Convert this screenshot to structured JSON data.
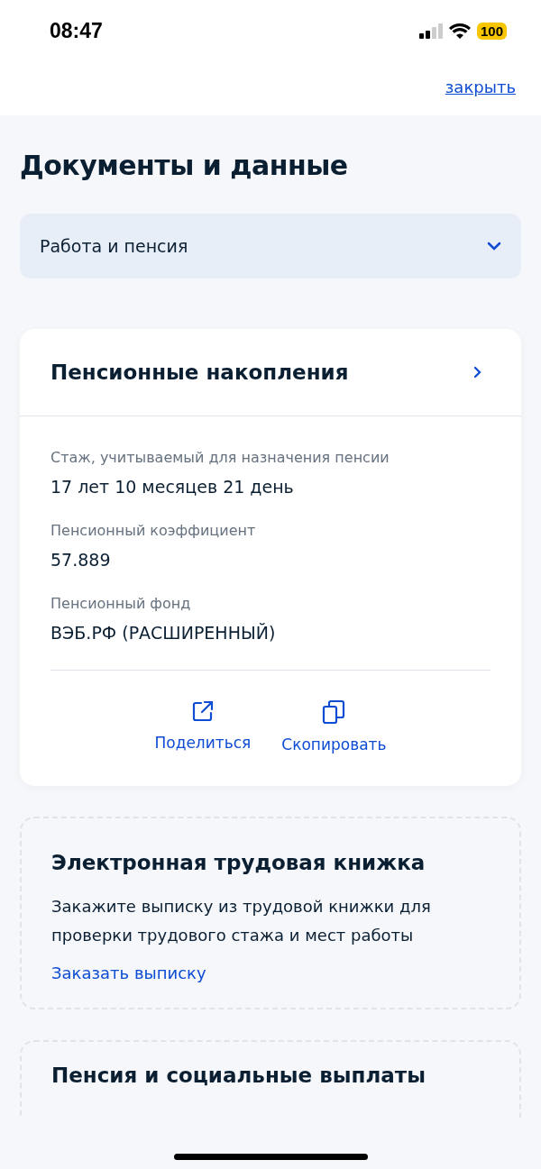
{
  "status_bar": {
    "time": "08:47",
    "battery": "100"
  },
  "close_link": "закрыть",
  "title": "Документы и данные",
  "category_select": {
    "value": "Работа и пенсия"
  },
  "pension_card": {
    "title": "Пенсионные накопления",
    "fields": [
      {
        "label": "Стаж, учитываемый для назначения пенсии",
        "value": "17 лет 10 месяцев 21 день"
      },
      {
        "label": "Пенсионный коэффициент",
        "value": "57.889"
      },
      {
        "label": "Пенсионный фонд",
        "value": "ВЭБ.РФ (РАСШИРЕННЫЙ)"
      }
    ],
    "actions": [
      {
        "kind": "share",
        "label": "Поделиться"
      },
      {
        "kind": "copy",
        "label": "Скопировать"
      }
    ]
  },
  "work_book_card": {
    "title": "Электронная трудовая книжка",
    "text": "Закажите выписку из трудовой книжки для проверки трудового стажа и мест работы",
    "link": "Заказать выписку"
  },
  "next_card": {
    "title": "Пенсия и социальные выплаты"
  }
}
